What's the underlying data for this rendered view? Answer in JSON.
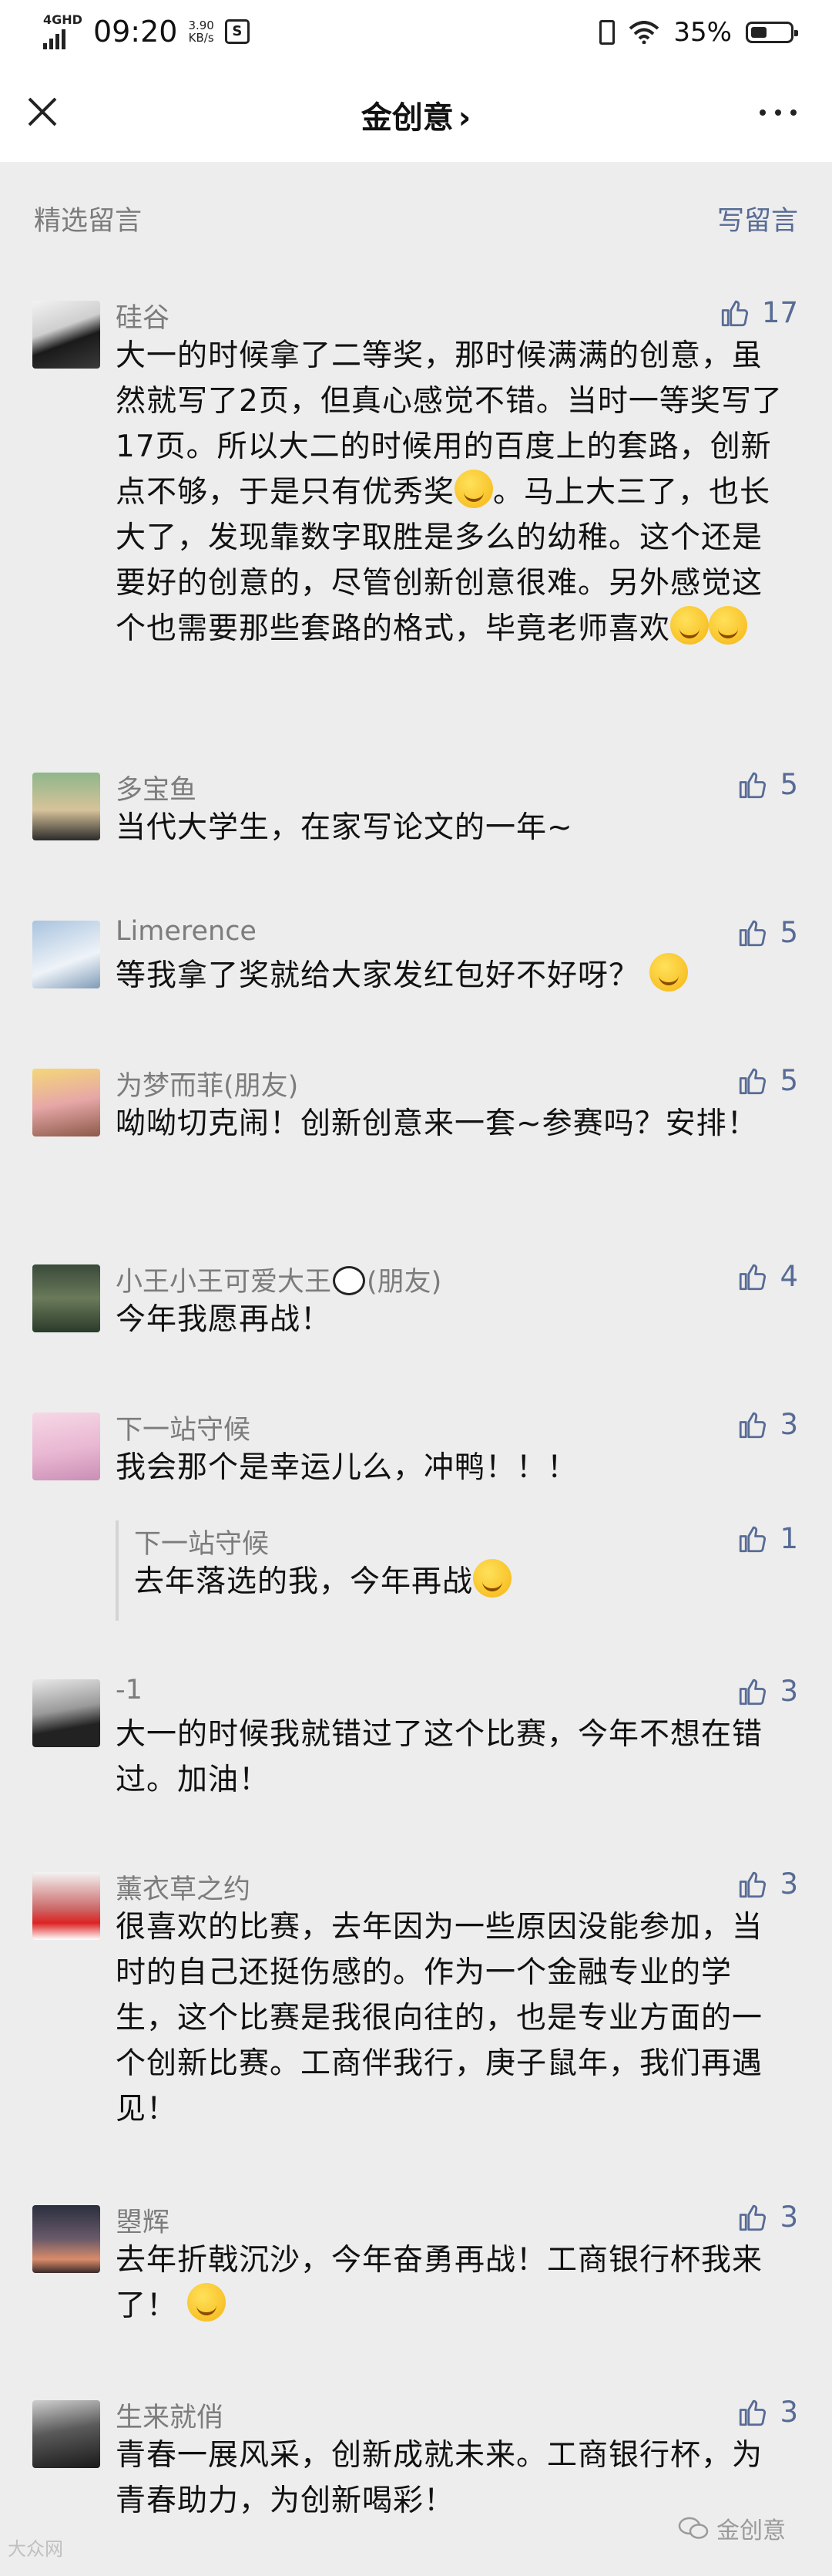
{
  "status_bar": {
    "network": "4GHD",
    "time": "09:20",
    "speed_value": "3.90",
    "speed_unit": "KB/s",
    "battery": "35%"
  },
  "nav": {
    "title": "金创意",
    "chevron": "›"
  },
  "section": {
    "label": "精选留言",
    "write": "写留言"
  },
  "comments": [
    {
      "name": "硅谷",
      "likes": "17",
      "text": "大一的时候拿了二等奖，那时候满满的创意，虽然就写了2页，但真心感觉不错。当时一等奖写了17页。所以大二的时候用的百度上的套路，创新点不够，于是只有优秀奖",
      "text2": "。马上大三了，也长大了，发现靠数字取胜是多么的幼稚。这个还是要好的创意的，尽管创新创意很难。另外感觉这个也需要那些套路的格式，毕竟老师喜欢"
    },
    {
      "name": "多宝鱼",
      "likes": "5",
      "text": "当代大学生，在家写论文的一年~"
    },
    {
      "name": "Limerence",
      "likes": "5",
      "text": "等我拿了奖就给大家发红包好不好呀？"
    },
    {
      "name": "为梦而菲(朋友)",
      "likes": "5",
      "text": "呦呦切克闹！创新创意来一套~参赛吗？安排！"
    },
    {
      "name": "小王小王可爱大王",
      "name_suffix": "(朋友)",
      "likes": "4",
      "text": "今年我愿再战！"
    },
    {
      "name": "下一站守候",
      "likes": "3",
      "text": "我会那个是幸运儿么，冲鸭！！！",
      "reply": {
        "name": "下一站守候",
        "likes": "1",
        "text": "去年落选的我，今年再战"
      }
    },
    {
      "name": "-1",
      "likes": "3",
      "text": "大一的时候我就错过了这个比赛，今年不想在错过。加油！"
    },
    {
      "name": "薰衣草之约",
      "likes": "3",
      "text": "很喜欢的比赛，去年因为一些原因没能参加，当时的自己还挺伤感的。作为一个金融专业的学生，这个比赛是我很向往的，也是专业方面的一个创新比赛。工商伴我行，庚子鼠年，我们再遇见！"
    },
    {
      "name": "曌辉",
      "likes": "3",
      "text": "去年折戟沉沙，今年奋勇再战！工商银行杯我来了！"
    },
    {
      "name": "生来就俏",
      "likes": "3",
      "text": "青春一展风采，创新成就未来。工商银行杯，为青春助力，为创新喝彩！"
    }
  ],
  "watermark": {
    "brand": "金创意",
    "left": "大众网"
  },
  "icons": {
    "close": "close-icon",
    "more": "more-dots-icon",
    "like": "thumbs-up-icon",
    "emoji": "emoji-icon"
  },
  "colors": {
    "link_blue": "#576b95",
    "background": "#ededed",
    "gray_text": "#7c7c7c"
  }
}
